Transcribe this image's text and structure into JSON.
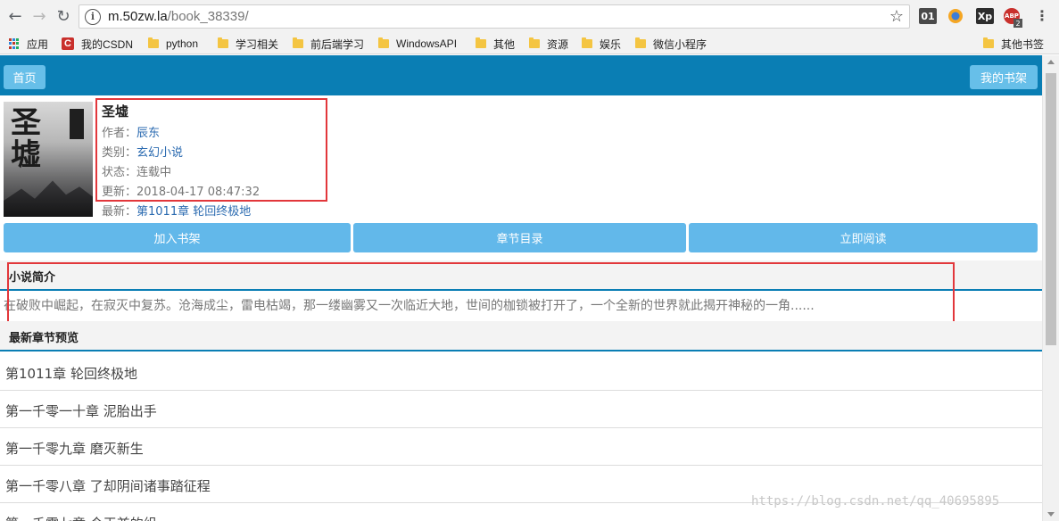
{
  "browser": {
    "url_host": "m.50zw.la",
    "url_path": "/book_38339/",
    "extensions": [
      "01",
      "Xp",
      "ABP",
      "2"
    ]
  },
  "bookmarks": [
    {
      "label": "应用",
      "icon": "apps-icon"
    },
    {
      "label": "我的CSDN",
      "icon": "csdn-icon"
    },
    {
      "label": "python",
      "icon": "folder-icon"
    },
    {
      "label": "学习相关",
      "icon": "folder-icon"
    },
    {
      "label": "前后端学习",
      "icon": "folder-icon"
    },
    {
      "label": "WindowsAPI",
      "icon": "folder-icon"
    },
    {
      "label": "其他",
      "icon": "folder-icon"
    },
    {
      "label": "资源",
      "icon": "folder-icon"
    },
    {
      "label": "娱乐",
      "icon": "folder-icon"
    },
    {
      "label": "微信小程序",
      "icon": "folder-icon"
    },
    {
      "label": "其他书签",
      "icon": "folder-icon"
    }
  ],
  "header": {
    "home_label": "首页",
    "bookshelf_label": "我的书架"
  },
  "book": {
    "title": "圣墟",
    "author_label": "作者：",
    "author": "辰东",
    "category_label": "类别：",
    "category": "玄幻小说",
    "status_label": "状态：",
    "status": "连载中",
    "updated_label": "更新：",
    "updated": "2018-04-17 08:47:32",
    "latest_label": "最新：",
    "latest": "第1011章 轮回终极地"
  },
  "actions": {
    "add_shelf": "加入书架",
    "toc": "章节目录",
    "read_now": "立即阅读"
  },
  "intro": {
    "heading": "小说简介",
    "text": "在破败中崛起，在寂灭中复苏。沧海成尘，雷电枯竭，那一缕幽雾又一次临近大地，世间的枷锁被打开了，一个全新的世界就此揭开神秘的一角......"
  },
  "latest_chapters": {
    "heading": "最新章节预览",
    "items": [
      "第1011章 轮回终极地",
      "第一千零一十章 泥胎出手",
      "第一千零九章 磨灭新生",
      "第一千零八章 了却阴间诸事踏征程",
      "第一千零七章 今王兼的组"
    ]
  },
  "watermark": "https://blog.csdn.net/qq_40695895",
  "colors": {
    "header_blue": "#0a7eb4",
    "button_blue": "#62b8ea",
    "highlight_red": "#e2373b",
    "link_blue": "#2a6ab0"
  }
}
